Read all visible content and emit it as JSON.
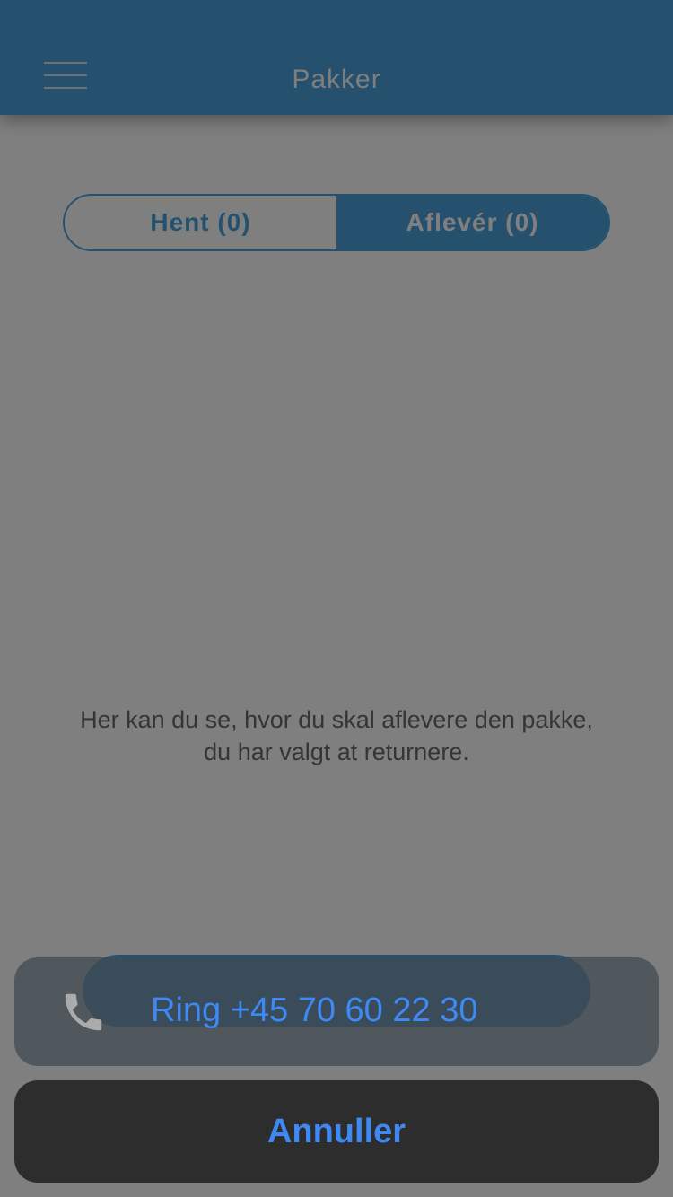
{
  "header": {
    "title": "Pakker"
  },
  "tabs": [
    {
      "label": "Hent (0)",
      "active": false
    },
    {
      "label": "Aflevér (0)",
      "active": true
    }
  ],
  "empty_state": {
    "message": "Her kan du se, hvor du skal aflevere den pakke, du har valgt at returnere."
  },
  "action_sheet": {
    "call_label": "Ring +45 70 60 22 30",
    "call_icon": "phone-icon",
    "cancel_label": "Annuller"
  },
  "colors": {
    "brand": "#4aa3df",
    "action_text": "#3f89f5"
  }
}
